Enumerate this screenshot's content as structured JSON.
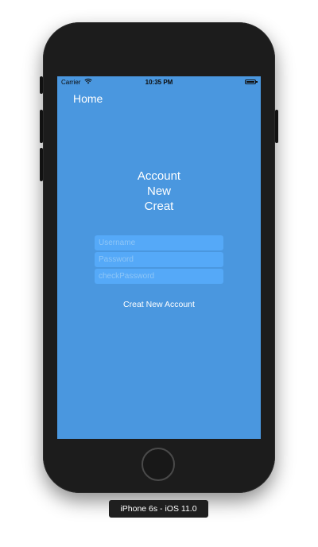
{
  "status_bar": {
    "carrier": "Carrier",
    "time": "10:35 PM",
    "wifi_icon": "wifi-icon",
    "battery_icon": "battery-icon"
  },
  "nav": {
    "home_label": "Home"
  },
  "title_lines": [
    "Account",
    "New",
    "Creat"
  ],
  "form": {
    "username_placeholder": "Username",
    "password_placeholder": "Password",
    "check_password_placeholder": "checkPassword",
    "submit_label": "Creat New Account"
  },
  "simulator": {
    "device_label": "iPhone 6s - iOS 11.0"
  },
  "colors": {
    "screen_background": "#4a97df",
    "field_background": "#55a9f8",
    "text": "#ffffff"
  }
}
